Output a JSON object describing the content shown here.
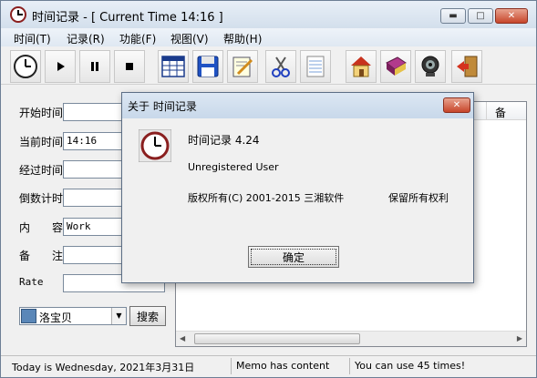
{
  "window": {
    "title": "时间记录 - [ Current Time 14:16 ]"
  },
  "menu": [
    "时间(T)",
    "记录(R)",
    "功能(F)",
    "视图(V)",
    "帮助(H)"
  ],
  "toolbar": [
    {
      "icon": "clock-icon"
    },
    {
      "icon": "play-icon"
    },
    {
      "icon": "pause-icon"
    },
    {
      "icon": "stop-icon"
    },
    {
      "icon": "calendar-grid-icon"
    },
    {
      "icon": "floppy-disk-icon"
    },
    {
      "icon": "notepad-pencil-icon"
    },
    {
      "icon": "scissors-icon"
    },
    {
      "icon": "lined-paper-icon"
    },
    {
      "icon": "home-icon"
    },
    {
      "icon": "book-icon"
    },
    {
      "icon": "webcam-icon"
    },
    {
      "icon": "exit-door-icon"
    }
  ],
  "form": {
    "start_time_label": "开始时间",
    "current_time_label": "当前时间",
    "current_time_value": "14:16",
    "elapsed_label": "经过时间",
    "countdown_label": "倒数计时",
    "content_label_a": "内",
    "content_label_b": "容",
    "content_value": "Work",
    "memo_label_a": "备",
    "memo_label_b": "注",
    "rate_label": "Rate",
    "search_engine": "洛宝贝",
    "search_button": "搜索"
  },
  "list": {
    "header_right": "备"
  },
  "status": {
    "date": "Today is Wednesday, 2021年3月31日",
    "memo": "Memo has content",
    "uses": "You can use 45 times!"
  },
  "dialog": {
    "title": "关于 时间记录",
    "app_name": "时间记录 4.24",
    "license": "Unregistered User",
    "copyright": "版权所有(C) 2001-2015 三湘软件",
    "rights": "保留所有权利",
    "ok": "确定"
  }
}
